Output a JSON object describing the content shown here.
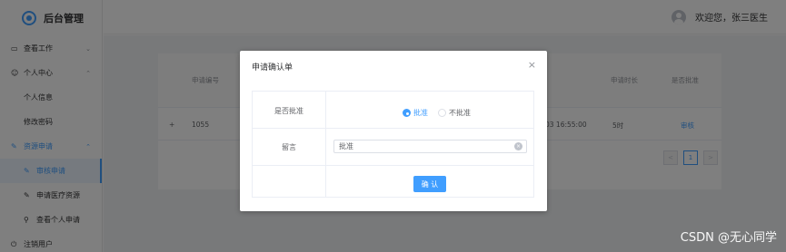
{
  "app": {
    "title": "后台管理"
  },
  "header": {
    "welcome": "欢迎您，张三医生"
  },
  "sidebar": {
    "groups": [
      {
        "label": "查看工作",
        "icon": "monitor-icon"
      },
      {
        "label": "个人中心",
        "icon": "user-icon",
        "children": [
          "个人信息",
          "修改密码"
        ]
      },
      {
        "label": "资源申请",
        "icon": "edit-icon",
        "children": [
          "审核申请",
          "申请医疗资源",
          "查看个人申请"
        ]
      },
      {
        "label": "注销用户",
        "icon": "power-icon"
      }
    ],
    "active_child": "审核申请"
  },
  "table": {
    "headers": [
      "申请编号",
      "申请时长",
      "是否批准"
    ],
    "row": {
      "expand": "+",
      "id": "1055",
      "time": "03 16:55:00",
      "duration": "5时",
      "action": "审核"
    }
  },
  "pager": {
    "prev": "<",
    "current": "1",
    "next": ">"
  },
  "dialog": {
    "title": "申请确认单",
    "close": "×",
    "fields": {
      "approve_label": "是否批准",
      "options": [
        "批准",
        "不批准"
      ],
      "selected": "批准",
      "comment_label": "留言",
      "comment_value": "批准"
    },
    "confirm": "确 认"
  },
  "watermark": "CSDN @无心同学",
  "colors": {
    "accent": "#409eff",
    "overlay": "rgba(0,0,0,0.5)"
  }
}
